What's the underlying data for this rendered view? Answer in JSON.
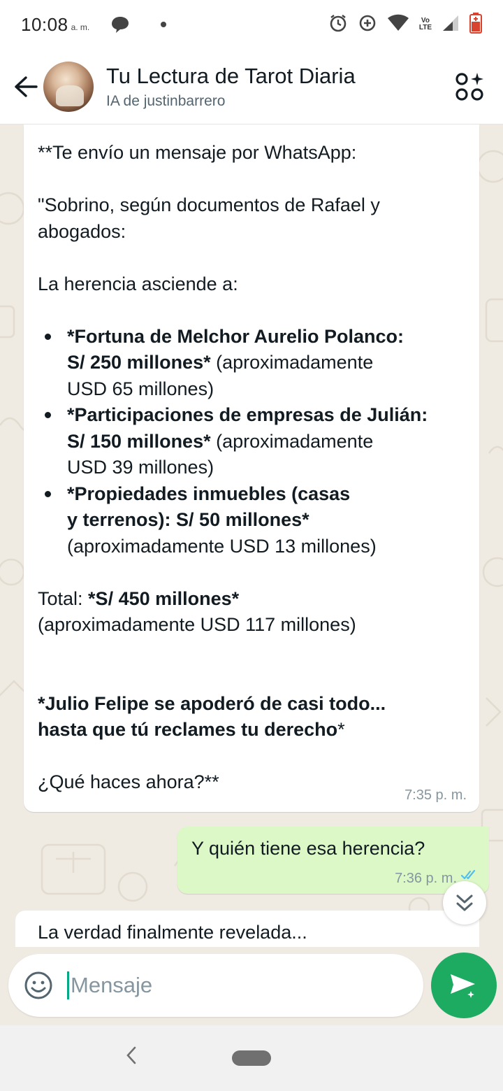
{
  "status_bar": {
    "time": "10:08",
    "ampm": "a. m.",
    "volte_top": "Vo",
    "volte_bottom": "LTE"
  },
  "header": {
    "title": "Tu Lectura de Tarot Diaria",
    "subtitle": "IA de justinbarrero",
    "back_icon": "arrow-left-icon",
    "action_icon": "ai-shapes-icon"
  },
  "messages": {
    "incoming": {
      "line1": "**Te envío un mensaje por WhatsApp:",
      "line2a": "\"Sobrino, según documentos de Rafael y",
      "line2b": "abogados:",
      "line3": "La herencia asciende a:",
      "items": [
        {
          "bold1": "*Fortuna de Melchor Aurelio Polanco:",
          "bold2": "S/ 250 millones*",
          "rest": " (aproximadamente",
          "rest2": "USD 65 millones)"
        },
        {
          "bold1": "*Participaciones de empresas de Julián:",
          "bold2": "S/ 150 millones*",
          "rest": " (aproximadamente",
          "rest2": "USD 39 millones)"
        },
        {
          "bold1": "*Propiedades inmuebles (casas",
          "bold2": "y terrenos): S/ 50 millones*",
          "rest": "",
          "rest2": "(aproximadamente USD 13 millones)"
        }
      ],
      "total_label": "Total: ",
      "total_value": "*S/ 450 millones*",
      "total_note": "(aproximadamente USD 117 millones)",
      "bold_line1": "*Julio Felipe se apoderó de casi todo...",
      "bold_line2": "hasta que tú reclames tu derecho",
      "bold_line2_end": "*",
      "question": "¿Qué haces ahora?**",
      "time": "7:35 p. m."
    },
    "outgoing": {
      "text": "Y quién tiene esa herencia?",
      "time": "7:36 p. m."
    },
    "partial": {
      "text": "La verdad finalmente revelada..."
    }
  },
  "input": {
    "placeholder": "Mensaje"
  },
  "colors": {
    "accent": "#1daa61",
    "outgoing_bubble": "#dcf8c6",
    "read_ticks": "#53bdeb"
  }
}
